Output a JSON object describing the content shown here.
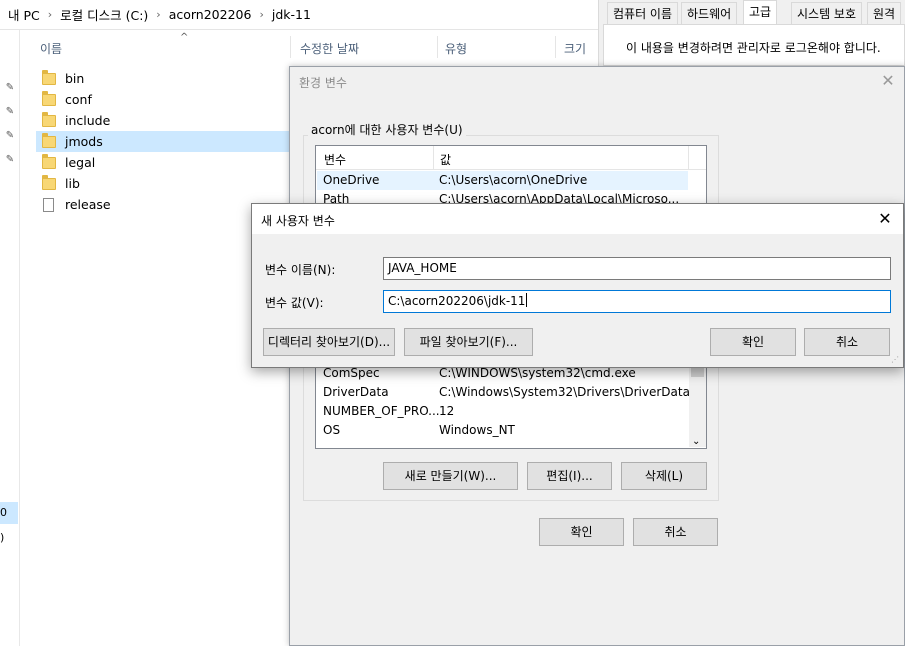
{
  "explorer": {
    "breadcrumb": [
      "내 PC",
      "로컬 디스크 (C:)",
      "acorn202206",
      "jdk-11"
    ],
    "columns": [
      "이름",
      "수정한 날짜",
      "유형",
      "크기"
    ],
    "files": [
      {
        "name": "bin",
        "icon": "folder-icon"
      },
      {
        "name": "conf",
        "icon": "folder-icon"
      },
      {
        "name": "include",
        "icon": "folder-icon"
      },
      {
        "name": "jmods",
        "icon": "folder-icon",
        "selected": true
      },
      {
        "name": "legal",
        "icon": "folder-icon"
      },
      {
        "name": "lib",
        "icon": "folder-icon"
      },
      {
        "name": "release",
        "icon": "file-icon"
      }
    ],
    "nav_selected_label": "0",
    "nav_label_below": ")"
  },
  "properties": {
    "tabs": [
      "컴퓨터 이름",
      "하드웨어",
      "고급",
      "시스템 보호",
      "원격"
    ],
    "active_tab": "고급",
    "message": "이 내용을 변경하려면 관리자로 로그온해야 합니다."
  },
  "env_dialog": {
    "title": "환경 변수",
    "user_group_label": "acorn에 대한 사용자 변수(U)",
    "list_headers": [
      "변수",
      "값"
    ],
    "user_vars": [
      {
        "name": "OneDrive",
        "value": "C:\\Users\\acorn\\OneDrive"
      },
      {
        "name": "Path",
        "value": "C:\\Users\\acorn\\AppData\\Local\\Microso..."
      }
    ],
    "system_vars": [
      {
        "name": "ComSpec",
        "value": "C:\\WINDOWS\\system32\\cmd.exe"
      },
      {
        "name": "DriverData",
        "value": "C:\\Windows\\System32\\Drivers\\DriverData"
      },
      {
        "name": "NUMBER_OF_PRO...",
        "value": "12"
      },
      {
        "name": "OS",
        "value": "Windows_NT"
      }
    ],
    "new_button": "새로 만들기(W)...",
    "edit_button": "편집(I)...",
    "delete_button": "삭제(L)",
    "ok_button": "확인",
    "cancel_button": "취소"
  },
  "new_var_dialog": {
    "title": "새 사용자 변수",
    "name_label": "변수 이름(N):",
    "value_label": "변수 값(V):",
    "name_value": "JAVA_HOME",
    "value_value": "C:\\acorn202206\\jdk-11",
    "browse_dir_button": "디렉터리 찾아보기(D)...",
    "browse_file_button": "파일 찾아보기(F)...",
    "ok_button": "확인",
    "cancel_button": "취소"
  }
}
